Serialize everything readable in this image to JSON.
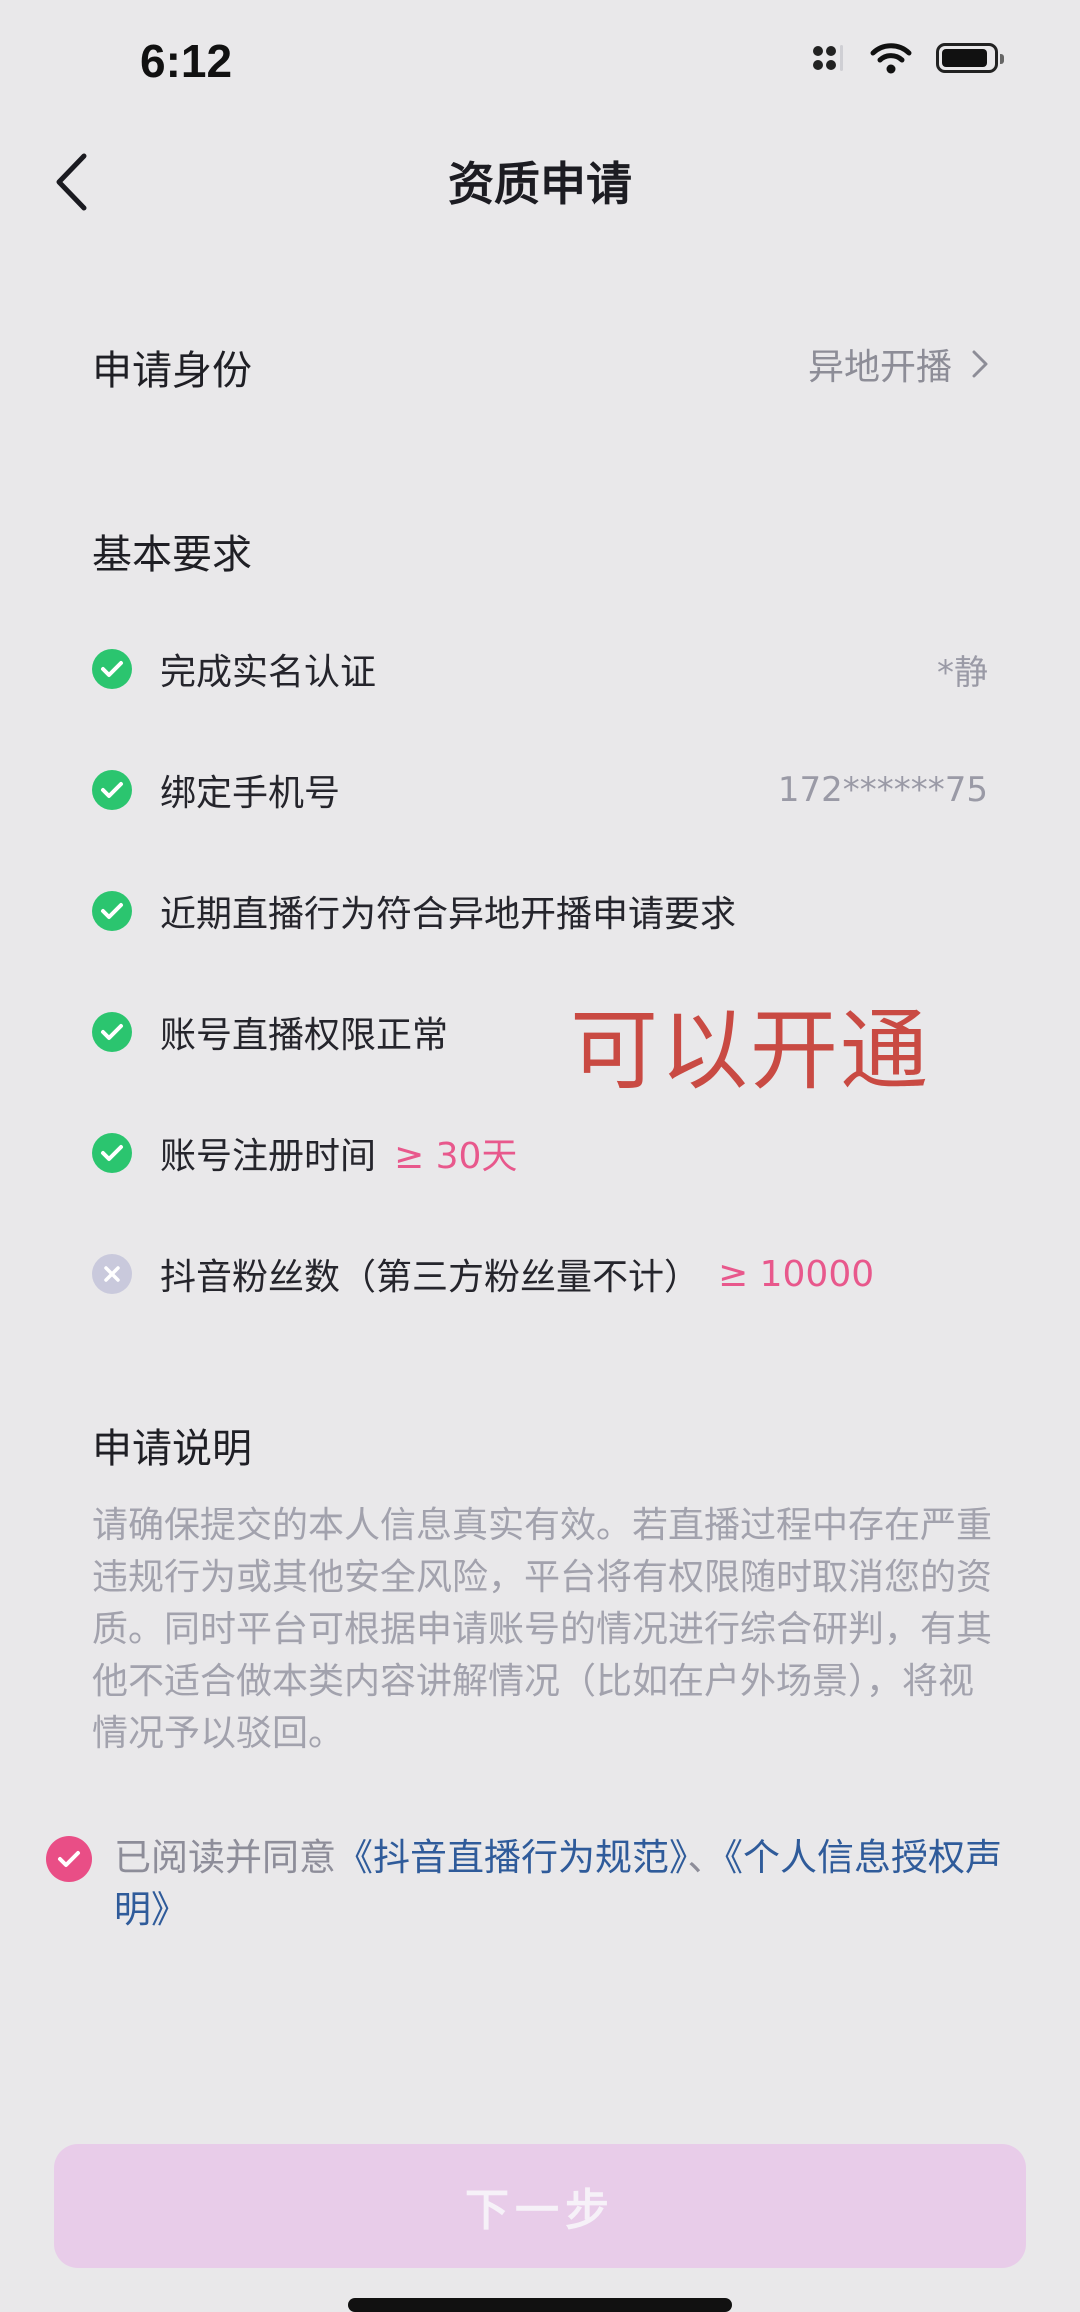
{
  "status_bar": {
    "time": "6:12"
  },
  "header": {
    "title": "资质申请"
  },
  "identity": {
    "label": "申请身份",
    "value": "异地开播"
  },
  "basic": {
    "title": "基本要求",
    "items": [
      {
        "label": "完成实名认证",
        "value": "*静",
        "requirement": "",
        "status": "done"
      },
      {
        "label": "绑定手机号",
        "value": "172******75",
        "requirement": "",
        "status": "done"
      },
      {
        "label": "近期直播行为符合异地开播申请要求",
        "value": "",
        "requirement": "",
        "status": "done"
      },
      {
        "label": "账号直播权限正常",
        "value": "",
        "requirement": "",
        "status": "done"
      },
      {
        "label": "账号注册时间",
        "value": "",
        "requirement": "≥ 30天",
        "status": "done"
      },
      {
        "label": "抖音粉丝数（第三方粉丝量不计）",
        "value": "",
        "requirement": "≥ 10000",
        "status": "failed"
      }
    ]
  },
  "annotation": "可以开通",
  "description": {
    "title": "申请说明",
    "text": "请确保提交的本人信息真实有效。若直播过程中存在严重违规行为或其他安全风险，平台将有权限随时取消您的资质。同时平台可根据申请账号的情况进行综合研判，有其他不适合做本类内容讲解情况（比如在户外场景），将视情况予以驳回。"
  },
  "agreement": {
    "prefix": "已阅读并同意",
    "link1": "《抖音直播行为规范》",
    "separator": "、",
    "link2": "《个人信息授权声明》",
    "checked": true
  },
  "footer": {
    "next_label": "下一步"
  },
  "colors": {
    "accent": "#e94e86",
    "check": "#2bc56f",
    "link": "#2f5b9a",
    "button_disabled": "#e8cce9",
    "annotation": "#c94a43"
  }
}
